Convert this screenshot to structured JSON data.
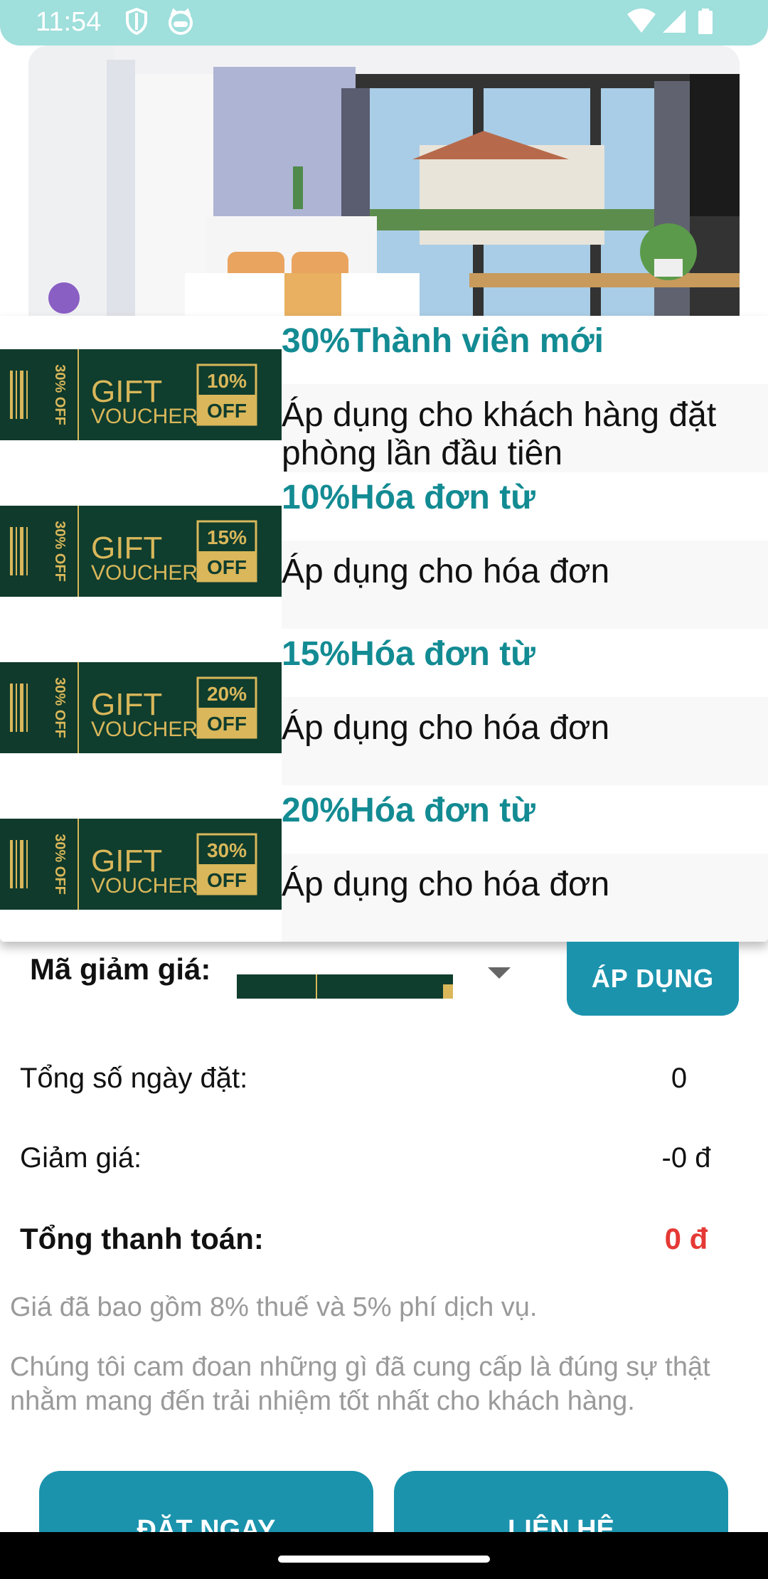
{
  "status_bar": {
    "time": "11:54",
    "left_icons": [
      "shield-icon",
      "cat-face-icon"
    ],
    "right_icons": [
      "wifi-icon",
      "cell-signal-icon",
      "battery-icon"
    ]
  },
  "room_photo": {
    "description_icon": "hotel-room-photo"
  },
  "voucher_popup": {
    "items": [
      {
        "title": "30%Thành viên mới",
        "description": "Áp dụng cho khách hàng đặt phòng lần đầu tiên",
        "badge": "10%",
        "badge_sub": "OFF",
        "side_label": "30% OFF",
        "gift": "GIFT",
        "voucher": "VOUCHER"
      },
      {
        "title": "10%Hóa đơn từ",
        "description": "Áp dụng cho hóa đơn",
        "badge": "15%",
        "badge_sub": "OFF",
        "side_label": "30% OFF",
        "gift": "GIFT",
        "voucher": "VOUCHER"
      },
      {
        "title": "15%Hóa đơn từ",
        "description": "Áp dụng cho hóa đơn",
        "badge": "20%",
        "badge_sub": "OFF",
        "side_label": "30% OFF",
        "gift": "GIFT",
        "voucher": "VOUCHER"
      },
      {
        "title": "20%Hóa đơn từ",
        "description": "Áp dụng cho hóa đơn",
        "badge": "30%",
        "badge_sub": "OFF",
        "side_label": "30% OFF",
        "gift": "GIFT",
        "voucher": "VOUCHER"
      }
    ]
  },
  "discount": {
    "label": "Mã giảm giá:",
    "apply_label": "ÁP DỤNG"
  },
  "summary": {
    "days_label": "Tổng số ngày đặt:",
    "days_value": "0",
    "discount_label": "Giảm giá:",
    "discount_value": "-0 đ",
    "total_label": "Tổng thanh toán:",
    "total_value": "0 đ"
  },
  "notes": {
    "tax": "Giá đã bao gồm 8% thuế và 5% phí dịch vụ.",
    "commitment": "Chúng tôi cam đoan những gì đã cung cấp là đúng sự thật nhằm mang đến trải nhiệm tốt nhất cho khách hàng."
  },
  "buttons": {
    "book_now": "ĐẶT NGAY",
    "contact": "LIÊN HỆ"
  },
  "colors": {
    "accent": "#1b93ad",
    "title_teal": "#138b93",
    "voucher_green": "#0f3d2e",
    "voucher_gold": "#d9b75a",
    "total_red": "#e53935",
    "status_bar": "#9fdfdc"
  }
}
